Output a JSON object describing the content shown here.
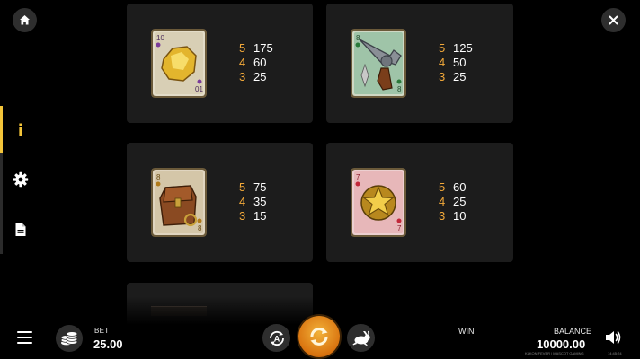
{
  "top_buttons": {
    "home_icon": "home-icon",
    "close_icon": "close-icon"
  },
  "side_menu": {
    "items": [
      {
        "name": "info",
        "icon": "info-icon",
        "glyph": "i",
        "active": true
      },
      {
        "name": "settings",
        "icon": "gear-icon",
        "active": false
      },
      {
        "name": "rules",
        "icon": "document-icon",
        "active": false
      }
    ],
    "accent_color": "#f3c43a"
  },
  "paytable": [
    {
      "symbol": "gold-nugget-card",
      "pays": [
        {
          "count": "5",
          "value": "175"
        },
        {
          "count": "4",
          "value": "60"
        },
        {
          "count": "3",
          "value": "25"
        }
      ]
    },
    {
      "symbol": "revolver-card",
      "pays": [
        {
          "count": "5",
          "value": "125"
        },
        {
          "count": "4",
          "value": "50"
        },
        {
          "count": "3",
          "value": "25"
        }
      ]
    },
    {
      "symbol": "saddlebag-card",
      "pays": [
        {
          "count": "5",
          "value": "75"
        },
        {
          "count": "4",
          "value": "35"
        },
        {
          "count": "3",
          "value": "15"
        }
      ]
    },
    {
      "symbol": "sheriff-badge-card",
      "pays": [
        {
          "count": "5",
          "value": "60"
        },
        {
          "count": "4",
          "value": "25"
        },
        {
          "count": "3",
          "value": "10"
        }
      ]
    }
  ],
  "bottom_bar": {
    "bet_label": "BET",
    "bet_value": "25.00",
    "win_label": "WIN",
    "balance_label": "BALANCE",
    "balance_value": "10000.00",
    "footer_text": "KLKON FEVER | MASCOT GAMING",
    "clock": "14:45:24",
    "spin_color": "#e8901e",
    "count_color": "#f3a93a"
  }
}
